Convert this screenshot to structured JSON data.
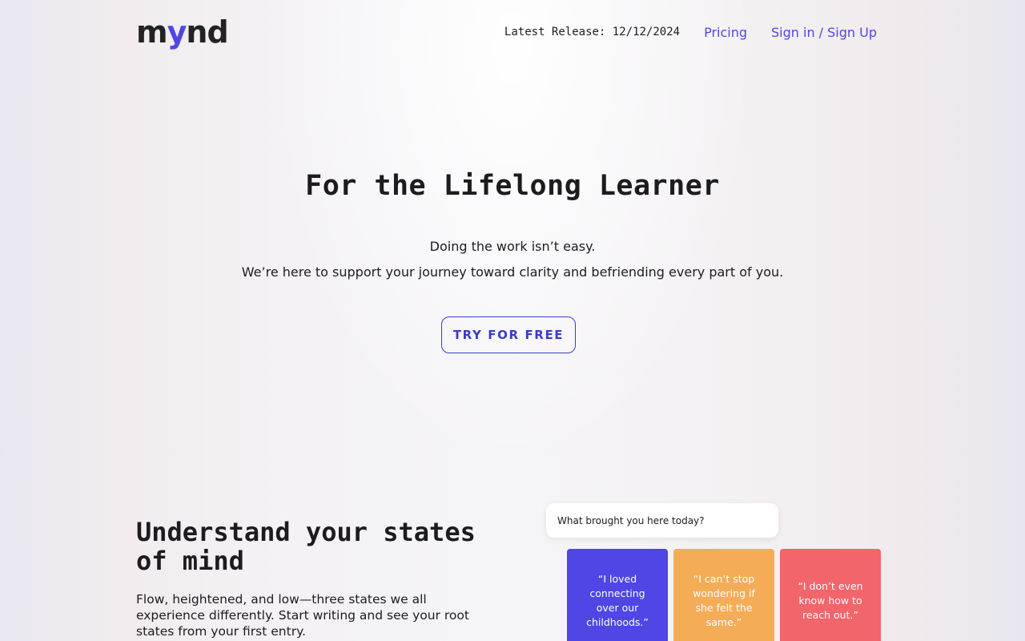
{
  "header": {
    "logo": {
      "prefix": "m",
      "accent": "y",
      "suffix": "nd"
    },
    "latest_release": "Latest Release: 12/12/2024",
    "pricing_label": "Pricing",
    "signin_label": "Sign in / Sign Up"
  },
  "hero": {
    "title": "For the Lifelong Learner",
    "line1": "Doing the work isn’t easy.",
    "line2": "We’re here to support your journey toward clarity and befriending every part of you.",
    "cta_label": "TRY FOR FREE"
  },
  "states_section": {
    "title": "Understand your states of mind",
    "description": "Flow, heightened, and low—three states we all experience differently. Start writing and see your root states from your first entry.",
    "prompt": "What brought you here today?",
    "quotes": [
      {
        "text": "“I loved connecting over our childhoods.”",
        "color": "#4f46e5"
      },
      {
        "text": "“I can’t stop wondering if she felt the same.”",
        "color": "#f4ad56"
      },
      {
        "text": "“I don’t even know how to reach out.”",
        "color": "#f2656a"
      }
    ]
  },
  "colors": {
    "accent": "#4f46e5",
    "cta_border": "#3b3bc9"
  }
}
